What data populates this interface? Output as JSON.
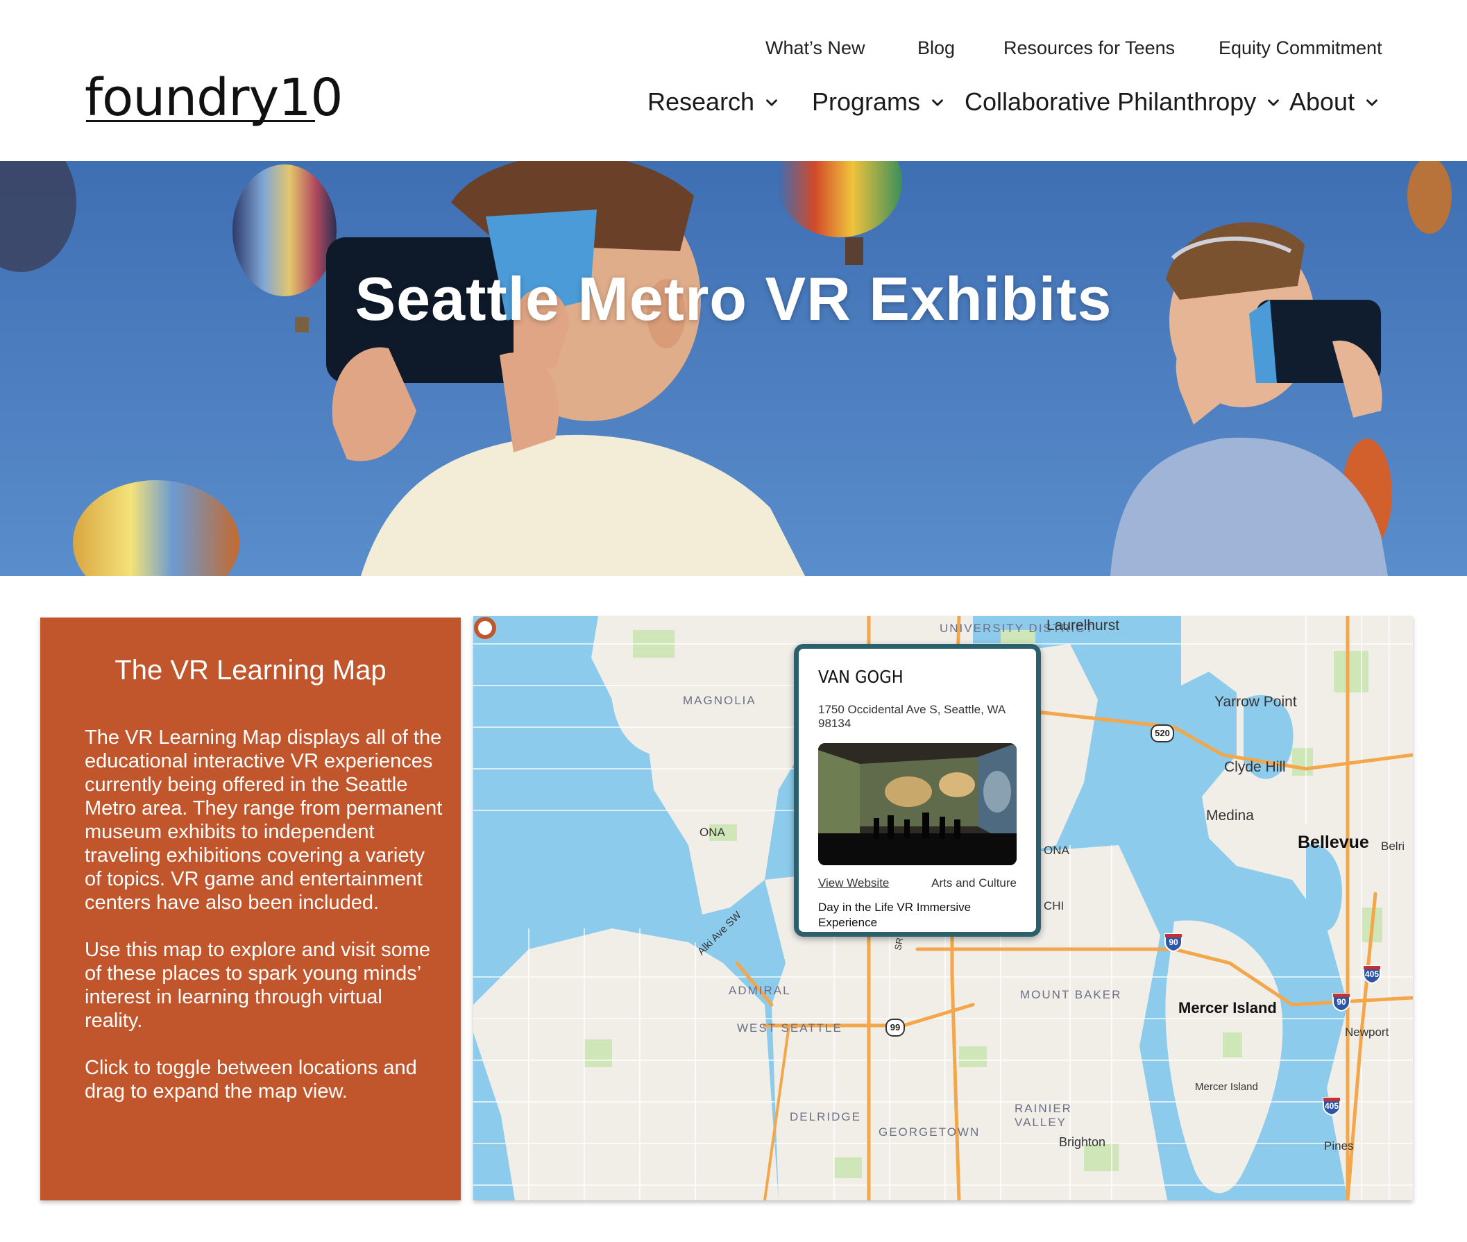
{
  "header": {
    "logo": "foundry10",
    "utility_links": [
      "What’s New",
      "Blog",
      "Resources for Teens",
      "Equity Commitment"
    ],
    "main_nav": [
      {
        "label": "Research"
      },
      {
        "label": "Programs"
      },
      {
        "label": "Collaborative Philanthropy"
      },
      {
        "label": "About"
      }
    ]
  },
  "hero": {
    "title": "Seattle Metro VR Exhibits"
  },
  "info_panel": {
    "title": "The VR Learning Map",
    "paragraphs": [
      "The VR Learning Map displays all of the educational interactive VR experiences currently being offered in the Seattle Metro area. They range from permanent museum exhibits to independent traveling exhibitions covering a variety of topics. VR game and entertainment centers have also been included.",
      "Use this map to explore and visit some of these places to spark young minds’ interest in learning through virtual reality.",
      "Click to toggle between locations and drag to expand the map view."
    ]
  },
  "map": {
    "labels": {
      "university_district": "UNIVERSITY DISTRICT",
      "laurelhurst": "Laurelhurst",
      "magnolia": "MAGNOLIA",
      "yarrow_point": "Yarrow Point",
      "clyde_hill": "Clyde Hill",
      "medina": "Medina",
      "bellevue": "Bellevue",
      "belrive": "Belri",
      "alki_ave": "Alki Ave SW",
      "admiral": "ADMIRAL",
      "west_seattle": "WEST SEATTLE",
      "mount_baker": "MOUNT BAKER",
      "mercer_island": "Mercer Island",
      "mercer_island_small": "Mercer Island",
      "newport": "Newport",
      "delridge": "DELRIDGE",
      "georgetown": "GEORGETOWN",
      "rainier_valley": "RAINIER VALLEY",
      "brighton": "Brighton",
      "pines": "Pines",
      "sr99": "SR 99",
      "ona": "ONA",
      "chi": "CHI"
    },
    "shields": {
      "sr520": "520",
      "sr99": "99",
      "i90a": "90",
      "i90b": "90",
      "i405a": "405",
      "i405b": "405"
    },
    "popup": {
      "title": "VAN GOGH",
      "address": "1750 Occidental Ave S, Seattle, WA 98134",
      "link_label": "View Website",
      "category": "Arts and Culture",
      "description": "Day in the Life VR Immersive Experience"
    },
    "colors": {
      "water": "#8ccbec",
      "land": "#f1eee8",
      "park": "#cfe7b8",
      "highway": "#f4a74a",
      "marker": "#c1552b",
      "popup_border": "#2b5f6b"
    }
  },
  "colors": {
    "panel": "#c1552b",
    "hero_sky": "#4d7fc0"
  }
}
